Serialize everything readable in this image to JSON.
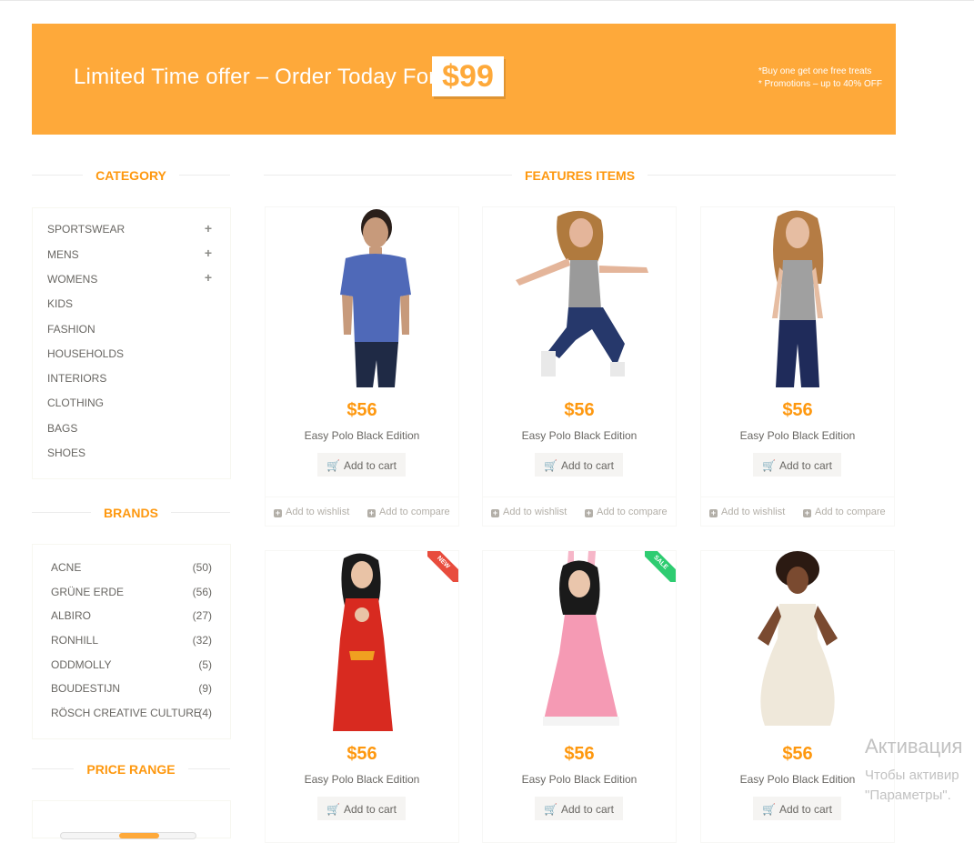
{
  "banner": {
    "text": "Limited Time offer – Order Today For",
    "price": "$99",
    "note1": "*Buy one get one free treats",
    "note2": "* Promotions – up to 40% OFF",
    "color": "#fea93a"
  },
  "sidebar": {
    "category_title": "CATEGORY",
    "categories": [
      {
        "label": "SPORTSWEAR",
        "expand": "+"
      },
      {
        "label": "MENS",
        "expand": "+"
      },
      {
        "label": "WOMENS",
        "expand": "+"
      },
      {
        "label": "KIDS"
      },
      {
        "label": "FASHION"
      },
      {
        "label": "HOUSEHOLDS"
      },
      {
        "label": "INTERIORS"
      },
      {
        "label": "CLOTHING"
      },
      {
        "label": "BAGS"
      },
      {
        "label": "SHOES"
      }
    ],
    "brands_title": "BRANDS",
    "brands": [
      {
        "name": "ACNE",
        "count": "(50)"
      },
      {
        "name": "GRÜNE ERDE",
        "count": "(56)"
      },
      {
        "name": "ALBIRO",
        "count": "(27)"
      },
      {
        "name": "RONHILL",
        "count": "(32)"
      },
      {
        "name": "ODDMOLLY",
        "count": "(5)"
      },
      {
        "name": "BOUDESTIJN",
        "count": "(9)"
      },
      {
        "name": "RÖSCH CREATIVE CULTURE",
        "count": "(4)"
      }
    ],
    "price_title": "PRICE RANGE"
  },
  "main": {
    "title": "FEATURES ITEMS",
    "products": [
      {
        "price": "$56",
        "name": "Easy Polo Black Edition",
        "cart": "Add to cart",
        "wishlist": "Add to wishlist",
        "compare": "Add to compare",
        "badge": ""
      },
      {
        "price": "$56",
        "name": "Easy Polo Black Edition",
        "cart": "Add to cart",
        "wishlist": "Add to wishlist",
        "compare": "Add to compare",
        "badge": ""
      },
      {
        "price": "$56",
        "name": "Easy Polo Black Edition",
        "cart": "Add to cart",
        "wishlist": "Add to wishlist",
        "compare": "Add to compare",
        "badge": ""
      },
      {
        "price": "$56",
        "name": "Easy Polo Black Edition",
        "cart": "Add to cart",
        "badge": "NEW"
      },
      {
        "price": "$56",
        "name": "Easy Polo Black Edition",
        "cart": "Add to cart",
        "badge": "SALE"
      },
      {
        "price": "$56",
        "name": "Easy Polo Black Edition",
        "cart": "Add to cart",
        "badge": ""
      }
    ]
  },
  "watermark": {
    "line1": "Активация",
    "line2": "Чтобы активир",
    "line3": "\"Параметры\"."
  },
  "colors": {
    "accent": "#fe980f",
    "new_badge": "#e84c3d",
    "sale_badge": "#2ecc71"
  }
}
